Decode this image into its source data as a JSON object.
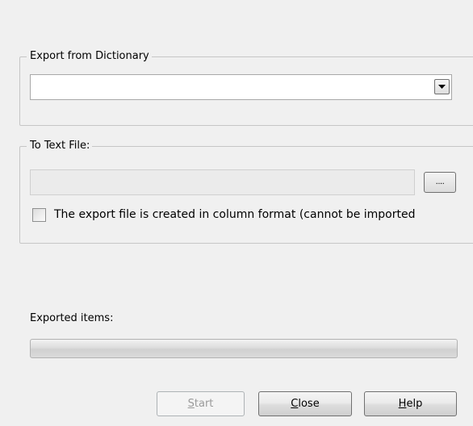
{
  "export_group": {
    "legend": "Export from Dictionary",
    "selected_dictionary": ""
  },
  "text_file_group": {
    "legend": "To Text File:",
    "path_value": "",
    "browse_label": "....",
    "column_format_label": "The export file is created in column format (cannot be imported",
    "column_format_checked": false
  },
  "progress": {
    "label": "Exported items:",
    "value_percent": 0
  },
  "buttons": {
    "start": {
      "mnemonic": "S",
      "rest": "tart",
      "enabled": false
    },
    "close": {
      "mnemonic": "C",
      "rest": "lose",
      "enabled": true
    },
    "help": {
      "mnemonic": "H",
      "rest": "elp",
      "enabled": true
    }
  }
}
